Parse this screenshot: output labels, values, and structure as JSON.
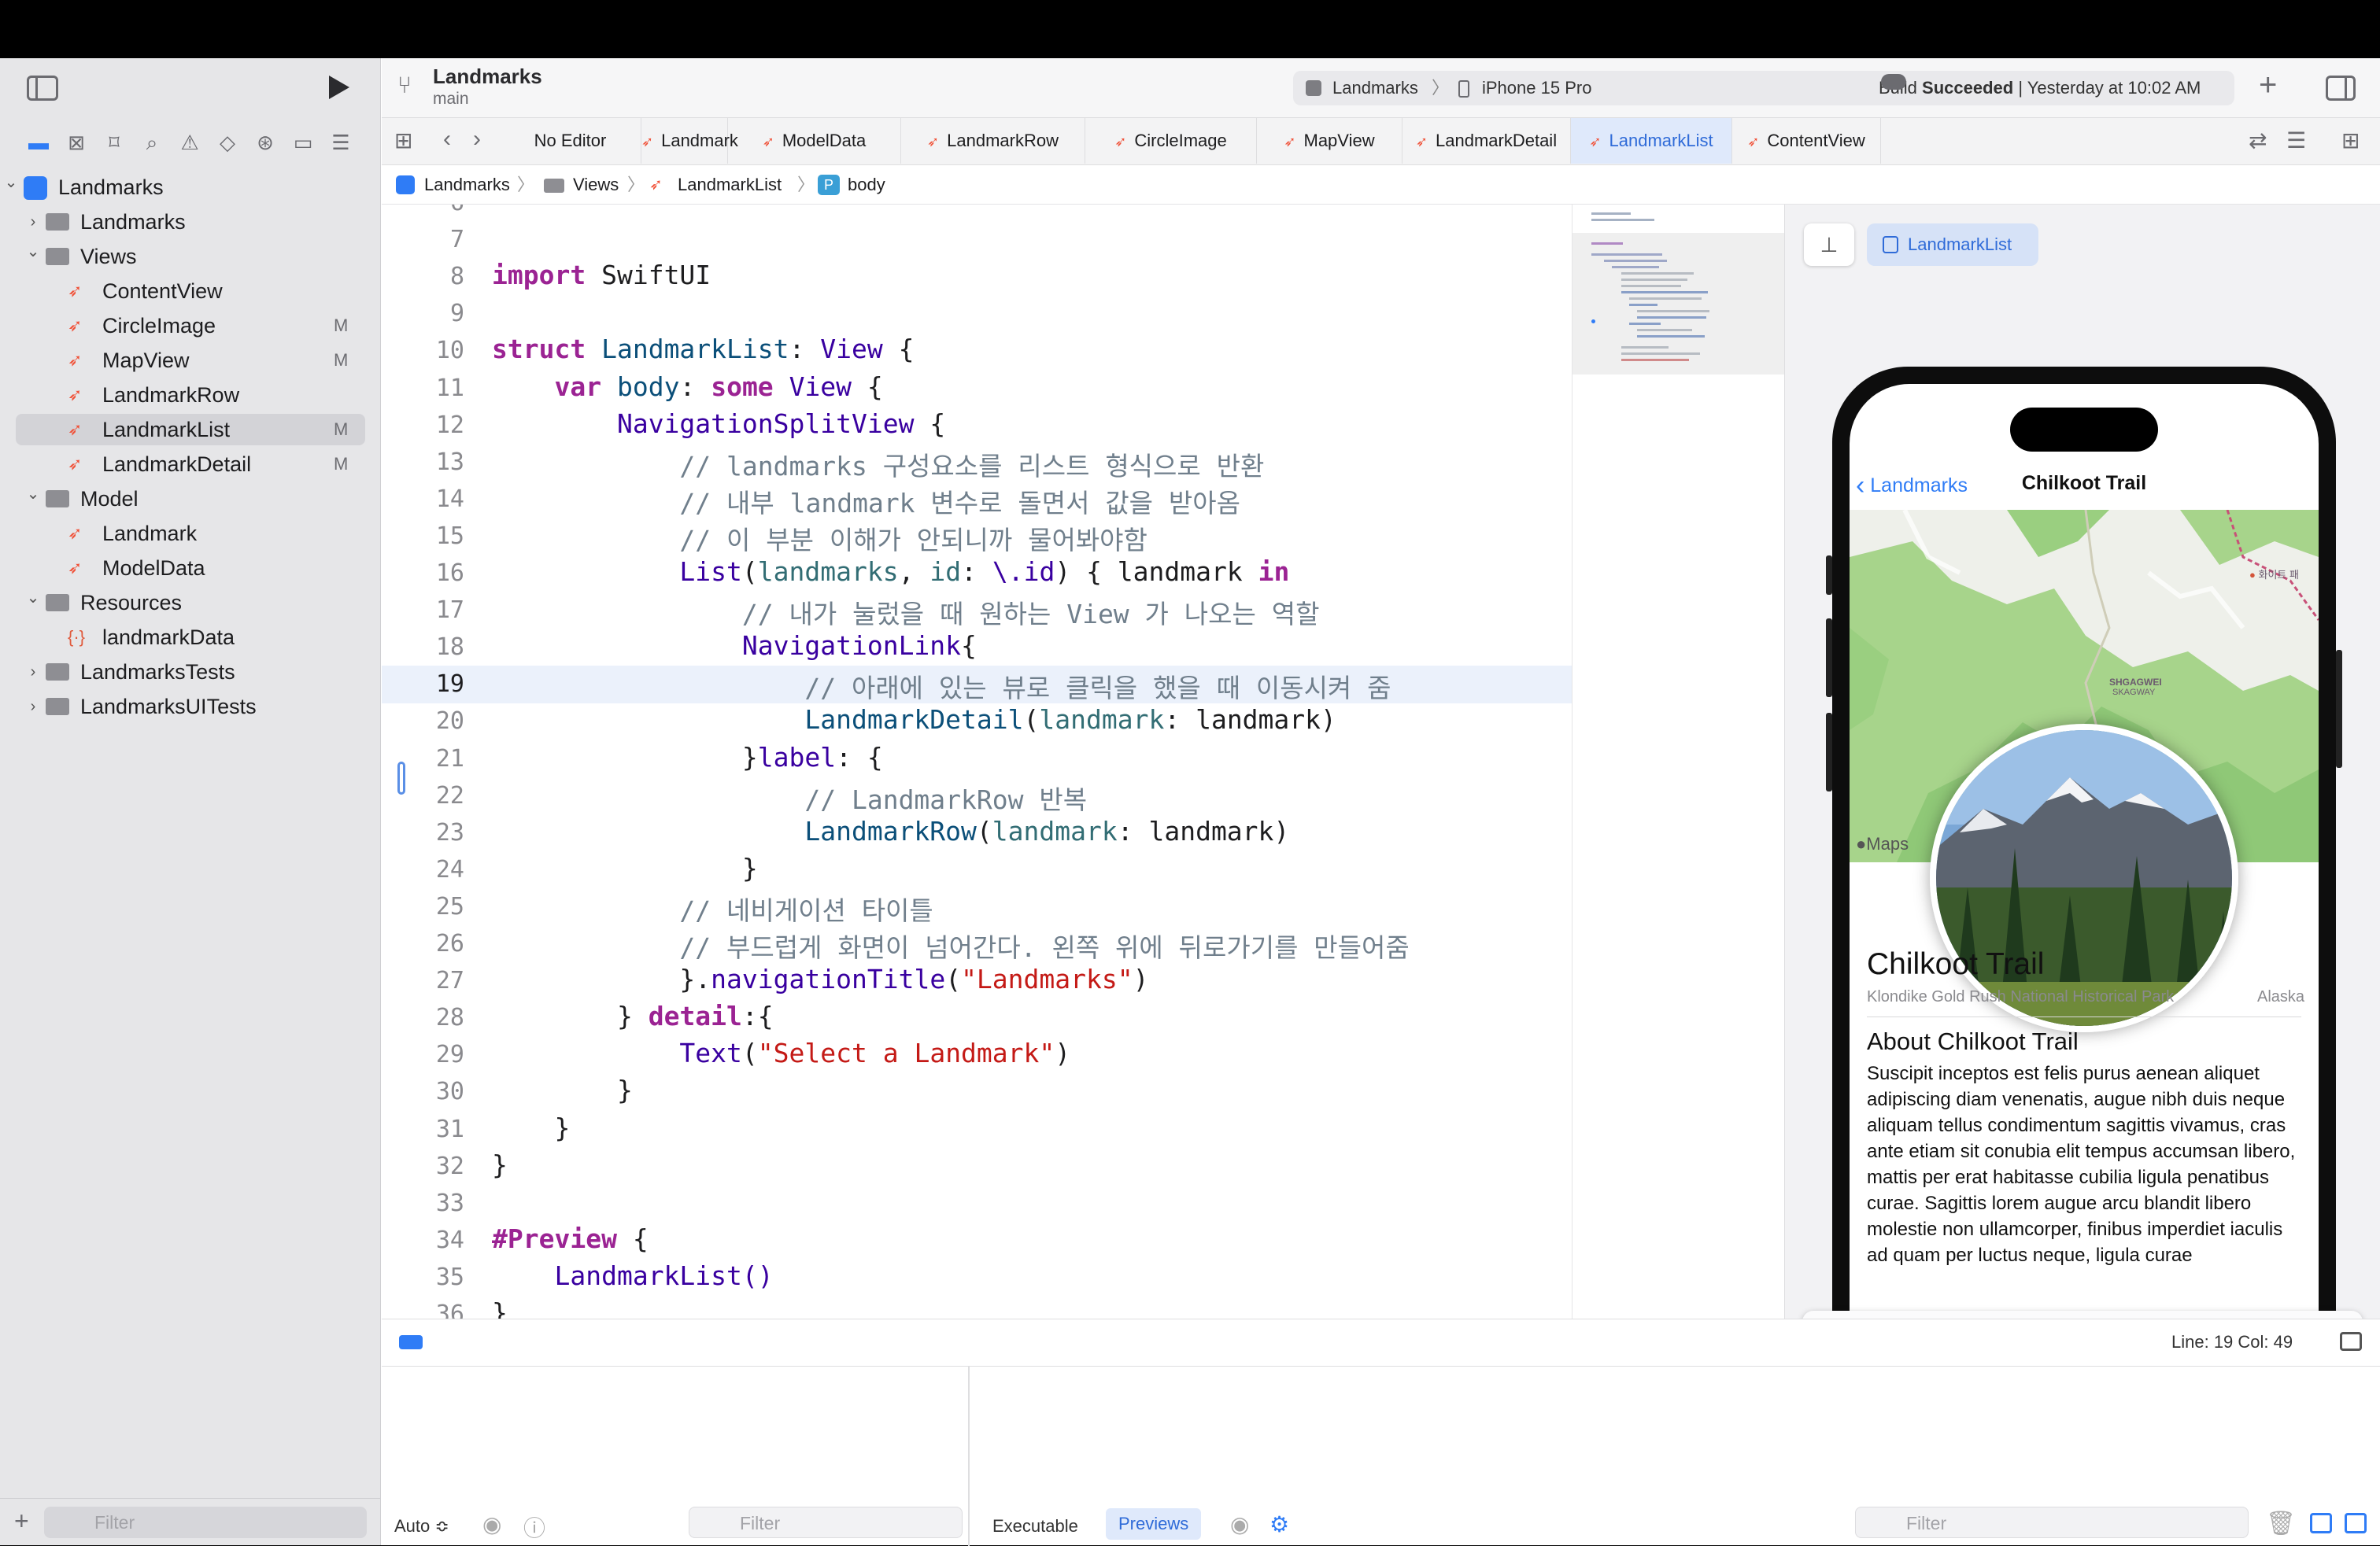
{
  "toolbar": {
    "project_title": "Landmarks",
    "branch": "main",
    "scheme_name": "Landmarks",
    "scheme_separator": "〉",
    "device": "iPhone 15 Pro",
    "build_status_prefix": "Build",
    "build_status": "Succeeded",
    "build_time": "| Yesterday at 10:02 AM"
  },
  "navigator": {
    "items": [
      {
        "label": "Landmarks",
        "kind": "project",
        "level": 0,
        "expanded": true
      },
      {
        "label": "Landmarks",
        "kind": "folder",
        "level": 1,
        "expanded": false
      },
      {
        "label": "Views",
        "kind": "folder",
        "level": 1,
        "expanded": true
      },
      {
        "label": "ContentView",
        "kind": "swift",
        "level": 2
      },
      {
        "label": "CircleImage",
        "kind": "swift",
        "level": 2,
        "flag": "M"
      },
      {
        "label": "MapView",
        "kind": "swift",
        "level": 2,
        "flag": "M"
      },
      {
        "label": "LandmarkRow",
        "kind": "swift",
        "level": 2
      },
      {
        "label": "LandmarkList",
        "kind": "swift",
        "level": 2,
        "flag": "M",
        "selected": true
      },
      {
        "label": "LandmarkDetail",
        "kind": "swift",
        "level": 2,
        "flag": "M"
      },
      {
        "label": "Model",
        "kind": "folder",
        "level": 1,
        "expanded": true
      },
      {
        "label": "Landmark",
        "kind": "swift",
        "level": 2
      },
      {
        "label": "ModelData",
        "kind": "swift",
        "level": 2
      },
      {
        "label": "Resources",
        "kind": "folder",
        "level": 1,
        "expanded": true
      },
      {
        "label": "landmarkData",
        "kind": "json",
        "level": 2
      },
      {
        "label": "LandmarksTests",
        "kind": "folder",
        "level": 1,
        "expanded": false
      },
      {
        "label": "LandmarksUITests",
        "kind": "folder",
        "level": 1,
        "expanded": false
      }
    ],
    "filter_placeholder": "Filter"
  },
  "tabs": [
    {
      "label": "No Editor",
      "swift": false
    },
    {
      "label": "Landmark",
      "swift": true
    },
    {
      "label": "ModelData",
      "swift": true
    },
    {
      "label": "LandmarkRow",
      "swift": true
    },
    {
      "label": "CircleImage",
      "swift": true
    },
    {
      "label": "MapView",
      "swift": true
    },
    {
      "label": "LandmarkDetail",
      "swift": true
    },
    {
      "label": "LandmarkList",
      "swift": true,
      "active": true
    },
    {
      "label": "ContentView",
      "swift": true
    }
  ],
  "jumpbar": {
    "c1": "Landmarks",
    "c2": "Views",
    "c3": "LandmarkList",
    "c4": "body",
    "sep": "〉"
  },
  "code": {
    "current_line": 19,
    "first_partial": "//",
    "lines": [
      {
        "n": "6"
      },
      {
        "n": "7"
      },
      {
        "n": "8"
      },
      {
        "n": "9"
      },
      {
        "n": "10"
      },
      {
        "n": "11"
      },
      {
        "n": "12"
      },
      {
        "n": "13"
      },
      {
        "n": "14"
      },
      {
        "n": "15"
      },
      {
        "n": "16"
      },
      {
        "n": "17"
      },
      {
        "n": "18"
      },
      {
        "n": "19"
      },
      {
        "n": "20"
      },
      {
        "n": "21"
      },
      {
        "n": "22"
      },
      {
        "n": "23"
      },
      {
        "n": "24"
      },
      {
        "n": "25"
      },
      {
        "n": "26"
      },
      {
        "n": "27"
      },
      {
        "n": "28"
      },
      {
        "n": "29"
      },
      {
        "n": "30"
      },
      {
        "n": "31"
      },
      {
        "n": "32"
      },
      {
        "n": "33"
      },
      {
        "n": "34"
      },
      {
        "n": "35"
      },
      {
        "n": "36"
      }
    ],
    "t": {
      "import": "import",
      "swiftui": "SwiftUI",
      "struct": "struct",
      "landmarklist": "LandmarkList",
      "colon": ":",
      "view": "View",
      "brace_open": " {",
      "var": "var",
      "body": "body",
      "some": "some",
      "navsplit": "NavigationSplitView",
      "c13": "// landmarks 구성요소를 리스트 형식으로 반환",
      "c14": "// 내부 landmark 변수로 돌면서 값을 받아옴",
      "c15": "// 이 부분 이해가 안되니까 물어봐야함",
      "list": "List",
      "landmarks": "landmarks",
      "id": "id",
      "kp": "\\.id",
      "landmark_in": ") { landmark ",
      "in": "in",
      "c17": "// 내가 눌렀을 때 원하는 View 가 나오는 역할",
      "navlink": "NavigationLink",
      "brace": "{",
      "c19": "// 아래에 있는 뷰로 클릭을 했을 때 이동시켜 줌",
      "detail_call": "LandmarkDetail",
      "landmark_lbl": "landmark",
      "landmark_arg": ": landmark)",
      "close_label": "}",
      "label": "label",
      "label_rest": ": {",
      "c22": "// LandmarkRow 반복",
      "row_call": "LandmarkRow",
      "close": "}",
      "c25": "// 네비게이션 타이틀",
      "c26": "// 부드럽게 화면이 넘어간다. 왼쪽 위에 뒤로가기를 만들어줌",
      "navtitle_pre": "}.",
      "navtitle": "navigationTitle",
      "navtitle_str": "\"Landmarks\"",
      "detail": "detail",
      "detail_rest": ":{",
      "text": "Text",
      "text_str": "\"Select a Landmark\"",
      "preview": "#Preview",
      "list_call": "LandmarkList()"
    }
  },
  "canvas": {
    "pin_icon": "pin-icon",
    "preview_chip": "LandmarkList",
    "nav_back": "Landmarks",
    "nav_title": "Chilkoot Trail",
    "map_label_1": "SHGAGWEI",
    "map_label_2": "SKAGWAY",
    "map_poi": "화이트 패",
    "maps_logo": "Maps",
    "title": "Chilkoot Trail",
    "park": "Klondike Gold Rush National Historical Park",
    "state": "Alaska",
    "about": "About Chilkoot Trail",
    "body": "Suscipit inceptos est felis purus aenean aliquet adipiscing diam venenatis, augue nibh duis neque aliquam tellus condimentum sagittis vivamus, cras ante etiam sit conubia elit tempus accumsan libero, mattis per erat habitasse cubilia ligula penatibus curae. Sagittis lorem augue arcu blandit libero molestie non ullamcorper, finibus imperdiet iaculis ad quam per luctus neque, ligula curae"
  },
  "status": {
    "line_col": "Line: 19  Col: 49"
  },
  "debug": {
    "auto": "Auto ≎",
    "filter_placeholder": "Filter",
    "executable": "Executable",
    "previews": "Previews",
    "filter2_placeholder": "Filter"
  },
  "colors": {
    "accent": "#2f7cf6",
    "swift": "#f05138",
    "keyword": "#9b2393",
    "comment": "#707f8c",
    "string": "#c41a16"
  }
}
